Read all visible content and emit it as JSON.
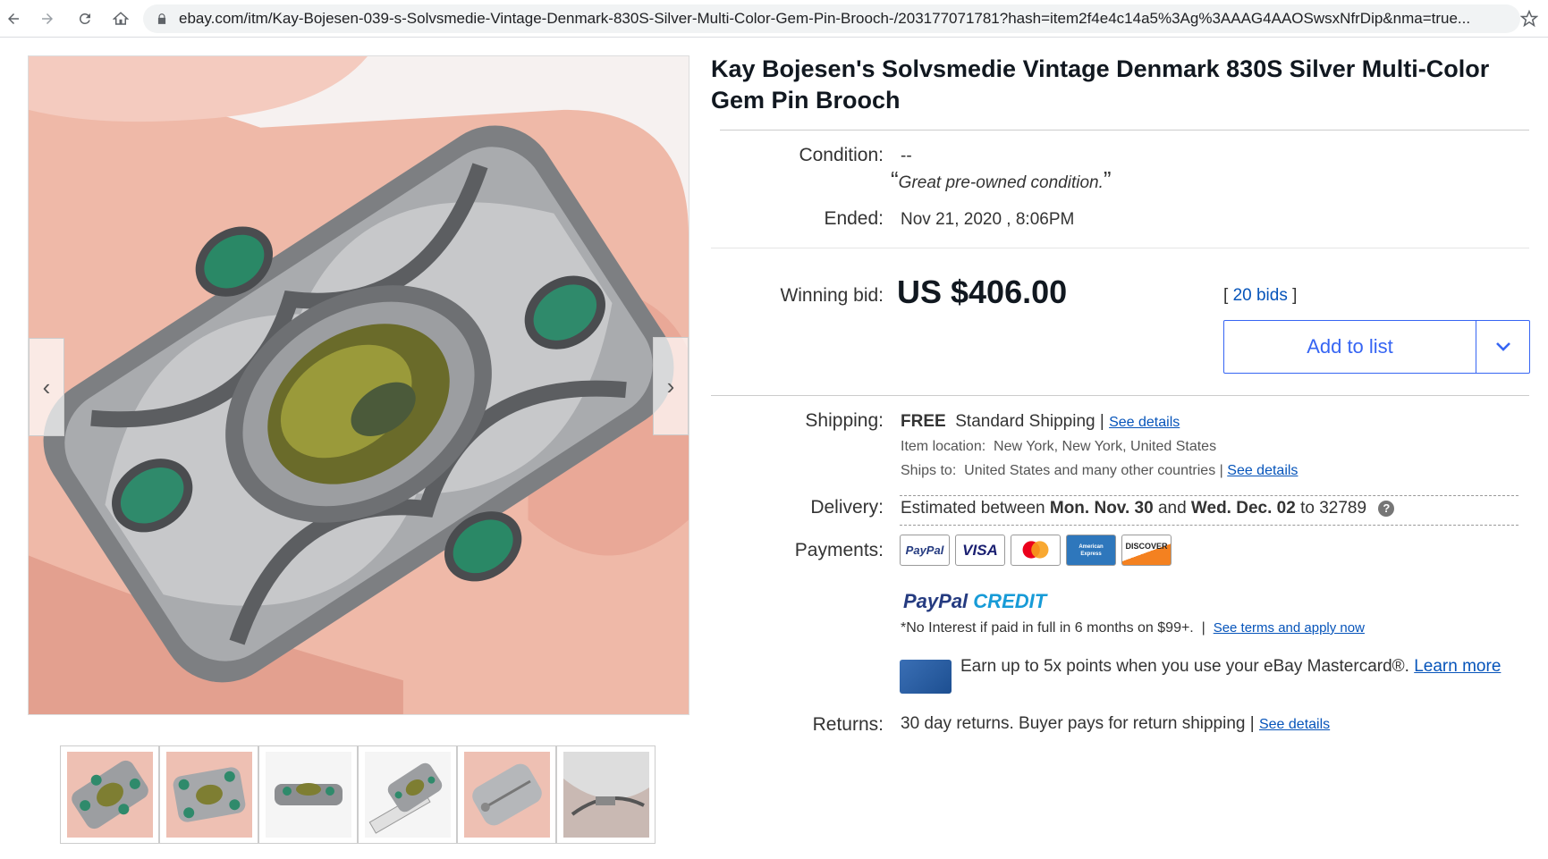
{
  "browser": {
    "url": "ebay.com/itm/Kay-Bojesen-039-s-Solvsmedie-Vintage-Denmark-830S-Silver-Multi-Color-Gem-Pin-Brooch-/203177071781?hash=item2f4e4c14a5%3Ag%3AAAG4AAOSwsxNfrDip&nma=true...",
    "icons": [
      "back-icon",
      "forward-icon",
      "reload-icon",
      "home-icon",
      "lock-icon",
      "star-icon"
    ]
  },
  "listing": {
    "title": "Kay Bojesen's Solvsmedie Vintage Denmark 830S Silver Multi-Color Gem Pin Brooch",
    "condition_label": "Condition:",
    "condition_value": "--",
    "condition_note": "Great pre-owned condition.",
    "ended_label": "Ended:",
    "ended_value": "Nov 21, 2020 , 8:06PM",
    "winning_bid_label": "Winning bid:",
    "winning_bid_value": "US $406.00",
    "bids_open": "[",
    "bids_link": "20 bids",
    "bids_close": "]",
    "add_to_list": "Add to list"
  },
  "shipping": {
    "label": "Shipping:",
    "free": "FREE",
    "method": "Standard Shipping",
    "separator": "|",
    "details_link": "See details",
    "location_label": "Item location:",
    "location_value": "New York, New York, United States",
    "ships_to_label": "Ships to:",
    "ships_to_value": "United States and many other countries",
    "ships_to_separator": "|",
    "ships_to_link": "See details"
  },
  "delivery": {
    "label": "Delivery:",
    "prefix": "Estimated between",
    "start": "Mon. Nov. 30",
    "and": "and",
    "end": "Wed. Dec. 02",
    "to": "to 32789",
    "help": "?"
  },
  "payments": {
    "label": "Payments:",
    "methods": [
      "PayPal",
      "VISA",
      "Mastercard",
      "American Express",
      "DISCOVER"
    ],
    "paypal_credit_a": "PayPal",
    "paypal_credit_b": "CREDIT",
    "no_interest": "*No Interest if paid in full in 6 months on $99+.",
    "separator": "|",
    "terms_link": "See terms and apply now",
    "mastercard_text": "Earn up to 5x points when you use your eBay Mastercard®.",
    "learn_more": "Learn more"
  },
  "returns": {
    "label": "Returns:",
    "value": "30 day returns. Buyer pays for return shipping",
    "separator": "|",
    "details_link": "See details"
  },
  "colors": {
    "link": "#0654ba",
    "button_blue": "#3665f3",
    "title": "#111820"
  },
  "gallery": {
    "thumbnail_count": 6,
    "arrow_left": "‹",
    "arrow_right": "›"
  }
}
